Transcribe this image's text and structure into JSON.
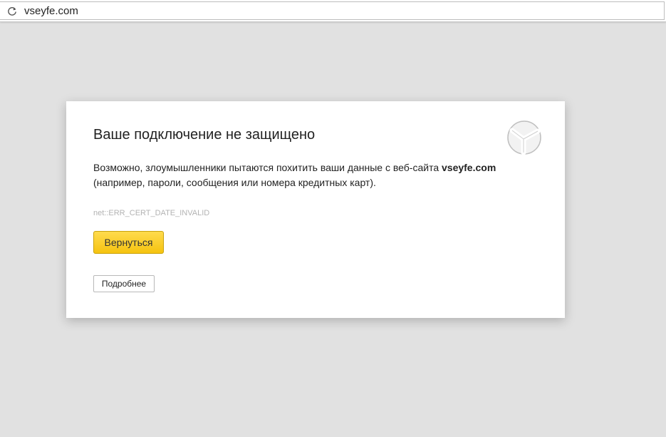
{
  "browser": {
    "url": "vseyfe.com",
    "reload_icon": "reload-icon"
  },
  "error_page": {
    "title": "Ваше подключение не защищено",
    "description_before": "Возможно, злоумышленники пытаются похитить ваши данные с веб-сайта ",
    "domain": "vseyfe.com",
    "description_after": " (например, пароли, сообщения или номера кредитных карт).",
    "error_code": "net::ERR_CERT_DATE_INVALID",
    "back_button_label": "Вернуться",
    "details_button_label": "Подробнее",
    "logo_icon": "yandex-browser-logo-icon"
  },
  "colors": {
    "background": "#e1e1e1",
    "card": "#ffffff",
    "back_button": "#ffdb4d",
    "error_code_text": "#b3b3b3"
  }
}
